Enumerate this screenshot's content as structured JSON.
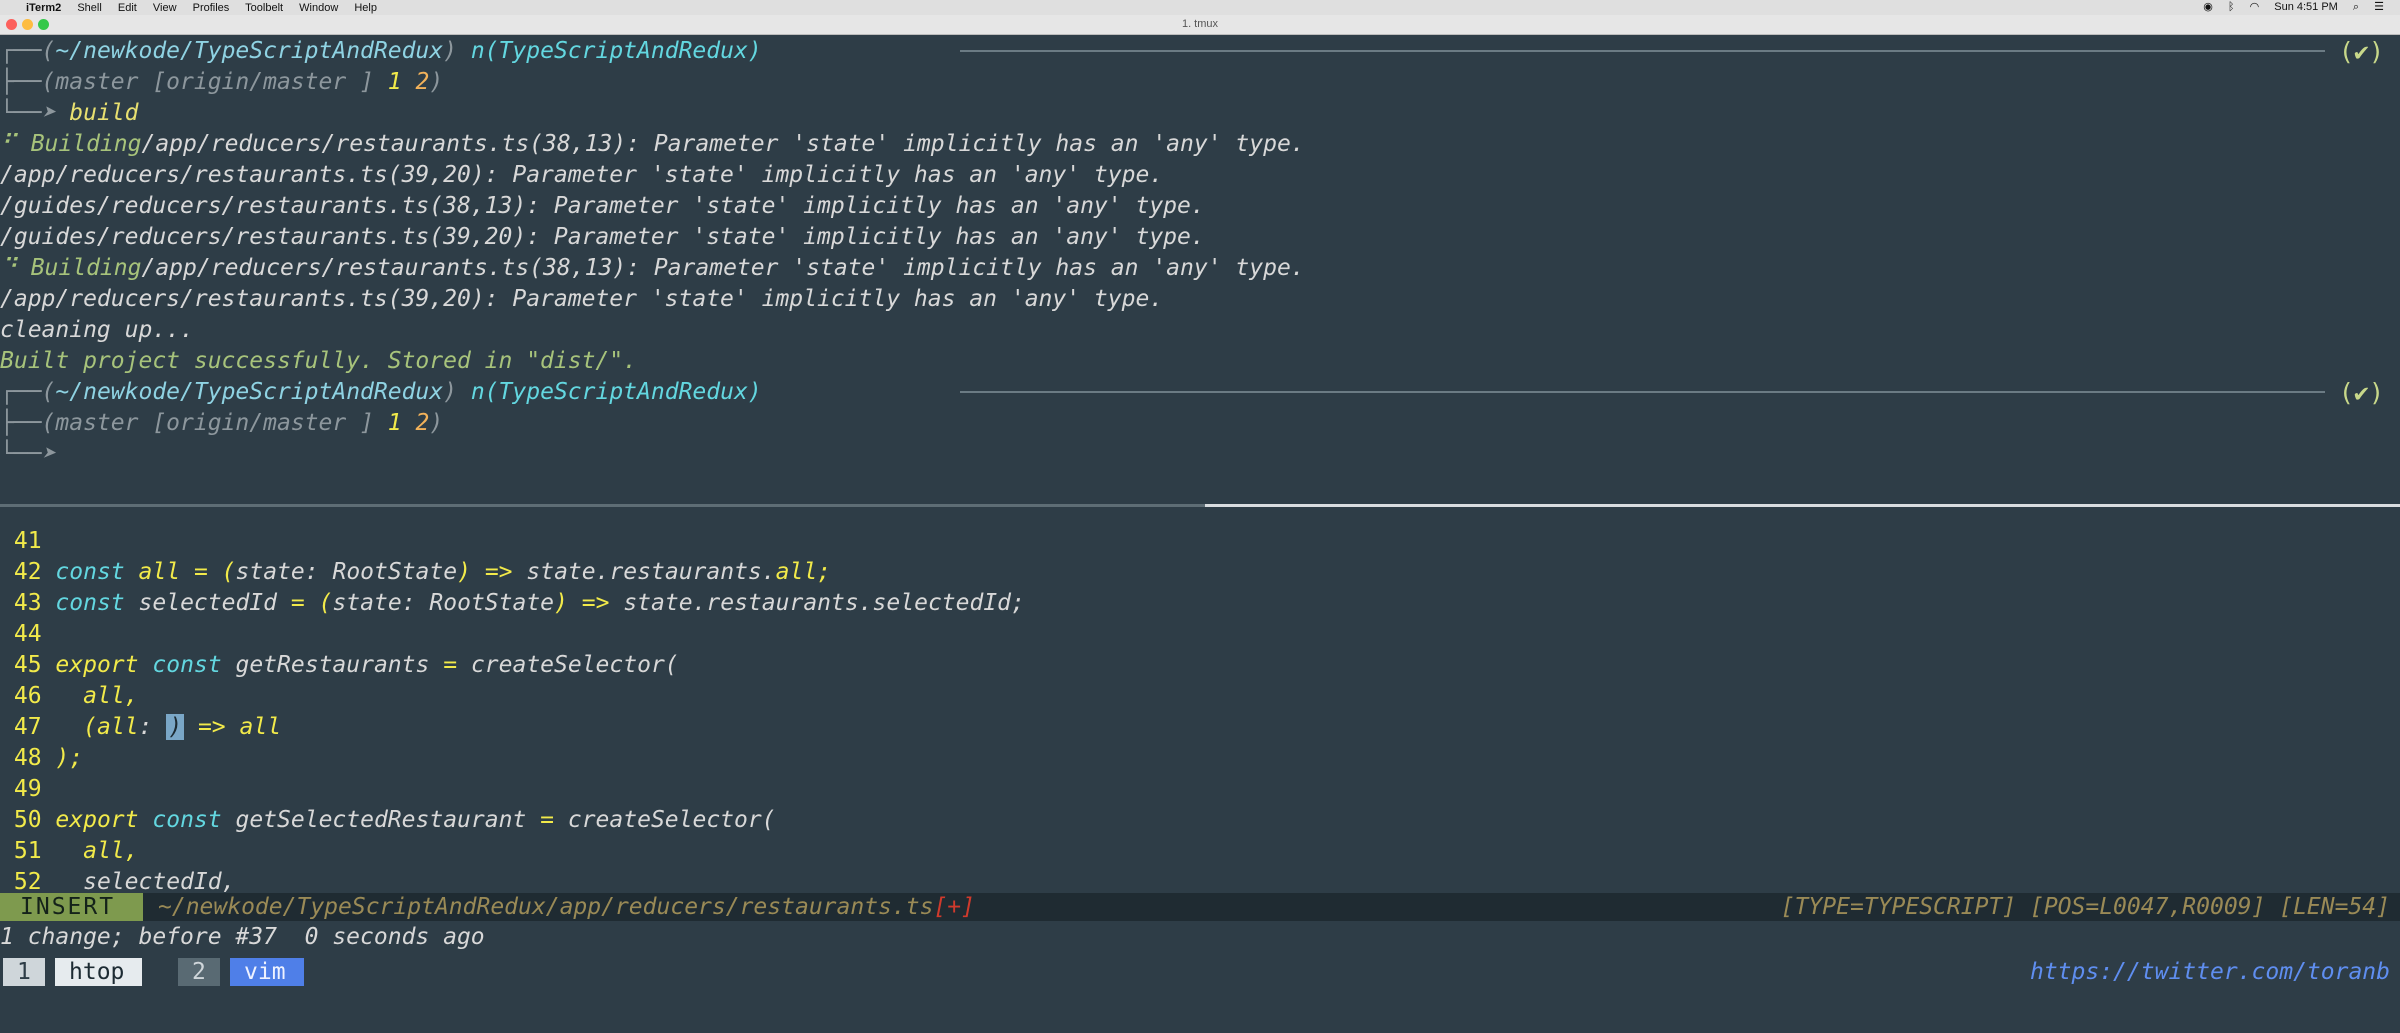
{
  "menubar": {
    "items": [
      "iTerm2",
      "Shell",
      "Edit",
      "View",
      "Profiles",
      "Toolbelt",
      "Window",
      "Help"
    ],
    "clock": "Sun 4:51 PM"
  },
  "window": {
    "title": "1. tmux"
  },
  "prompt1": {
    "path": "~/newkode/TypeScriptAndRedux",
    "node": "n(TypeScriptAndRedux)",
    "git": "(master [origin/master ]",
    "n1": "1",
    "n2": "2",
    "command": "build"
  },
  "output": [
    {
      "prefix": "⠋ Building",
      "text": "/app/reducers/restaurants.ts(38,13): Parameter 'state' implicitly has an 'any' type."
    },
    {
      "prefix": "",
      "text": "/app/reducers/restaurants.ts(39,20): Parameter 'state' implicitly has an 'any' type."
    },
    {
      "prefix": "",
      "text": "/guides/reducers/restaurants.ts(38,13): Parameter 'state' implicitly has an 'any' type."
    },
    {
      "prefix": "",
      "text": "/guides/reducers/restaurants.ts(39,20): Parameter 'state' implicitly has an 'any' type."
    },
    {
      "prefix": "⠙ Building",
      "text": "/app/reducers/restaurants.ts(38,13): Parameter 'state' implicitly has an 'any' type."
    },
    {
      "prefix": "",
      "text": "/app/reducers/restaurants.ts(39,20): Parameter 'state' implicitly has an 'any' type."
    },
    {
      "prefix": "",
      "text": "cleaning up..."
    }
  ],
  "success": "Built project successfully. Stored in \"dist/\".",
  "prompt2": {
    "path": "~/newkode/TypeScriptAndRedux",
    "node": "n(TypeScriptAndRedux)",
    "git": "(master [origin/master ]",
    "n1": "1",
    "n2": "2"
  },
  "check": "(✔)",
  "editor": {
    "lines": [
      {
        "no": "41"
      },
      {
        "no": "42"
      },
      {
        "no": "43"
      },
      {
        "no": "44"
      },
      {
        "no": "45"
      },
      {
        "no": "46"
      },
      {
        "no": "47"
      },
      {
        "no": "48"
      },
      {
        "no": "49"
      },
      {
        "no": "50"
      },
      {
        "no": "51"
      },
      {
        "no": "52"
      }
    ],
    "code": {
      "l42": [
        "const",
        "all",
        "=",
        "(",
        "state:",
        "RootState",
        ")",
        "=>",
        "state.restaurants.",
        "all",
        ";"
      ],
      "l43": [
        "const",
        "selectedId",
        "=",
        "(",
        "state:",
        "RootState",
        ")",
        "=>",
        "state.restaurants.selectedId;"
      ],
      "l45": [
        "export",
        "const",
        "getRestaurants",
        "=",
        "createSelector("
      ],
      "l46": [
        "all,"
      ],
      "l47": [
        "(",
        "all",
        ":",
        ")",
        "=>",
        "all"
      ],
      "l48": [
        ");"
      ],
      "l50": [
        "export",
        "const",
        "getSelectedRestaurant",
        "=",
        "createSelector("
      ],
      "l51": [
        "all,"
      ],
      "l52": [
        "selectedId,"
      ]
    }
  },
  "status": {
    "mode": "INSERT",
    "file": "~/newkode/TypeScriptAndRedux/app/reducers/restaurants.ts",
    "modified": "[+]",
    "right": "[TYPE=TYPESCRIPT] [POS=L0047,R0009] [LEN=54]"
  },
  "message": "1 change; before #37  0 seconds ago",
  "tabs": [
    {
      "num": "1",
      "name": "htop"
    },
    {
      "num": "2",
      "name": "vim"
    }
  ],
  "twitter": "https://twitter.com/toranb",
  "colors": {
    "background": "#2e3d47",
    "cyan": "#63d7e0",
    "yellow": "#f2ea4a",
    "green": "#a7c37b",
    "mode_bg": "#7e9a4e",
    "tab_active": "#4f7fe8",
    "link": "#5f8ef0"
  }
}
